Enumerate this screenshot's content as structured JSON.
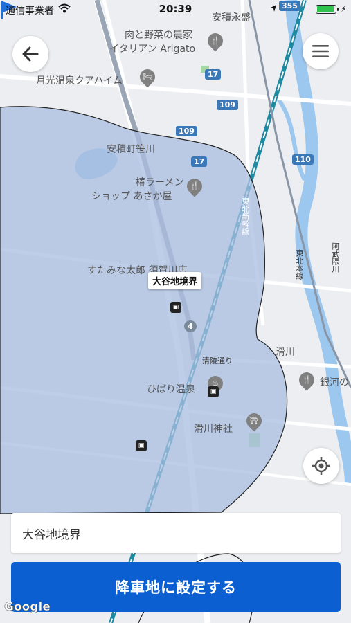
{
  "status_bar": {
    "carrier": "通信事業者",
    "time": "20:39",
    "battery_level": 0.92
  },
  "map": {
    "labels": {
      "top_station": "安積永盛",
      "restaurant_top": "肉と野菜の農家",
      "restaurant_top_2": "イタリアン Arigato",
      "hotel": "月光温泉クアハイム",
      "town": "安積町笹川",
      "ramen_1": "椿ラーメン",
      "ramen_2": "ショップ あさか屋",
      "sumitaro": "すたみな太郎 須賀川店",
      "seiryo": "清陵通り",
      "hibari": "ひばり温泉",
      "namekawa_shrine": "滑川神社",
      "namekawa": "滑川",
      "ginga": "銀河の",
      "abukuma": "阿武隈川",
      "tohoku_shinkansen": "東北新幹線",
      "tohoku_line": "東北本線"
    },
    "routes": {
      "r355": "355",
      "r17a": "17",
      "r109a": "109",
      "r109b": "109",
      "r17b": "17",
      "r110": "110",
      "r4": "4"
    },
    "pin_label": "大谷地境界"
  },
  "address_field": {
    "value": "大谷地境界"
  },
  "confirm_button": {
    "label": "降車地に設定する"
  },
  "attribution": "Google",
  "colors": {
    "accent": "#0b5fd0",
    "area_overlay": "#a9bde0",
    "flag": "#1e6fd9"
  }
}
